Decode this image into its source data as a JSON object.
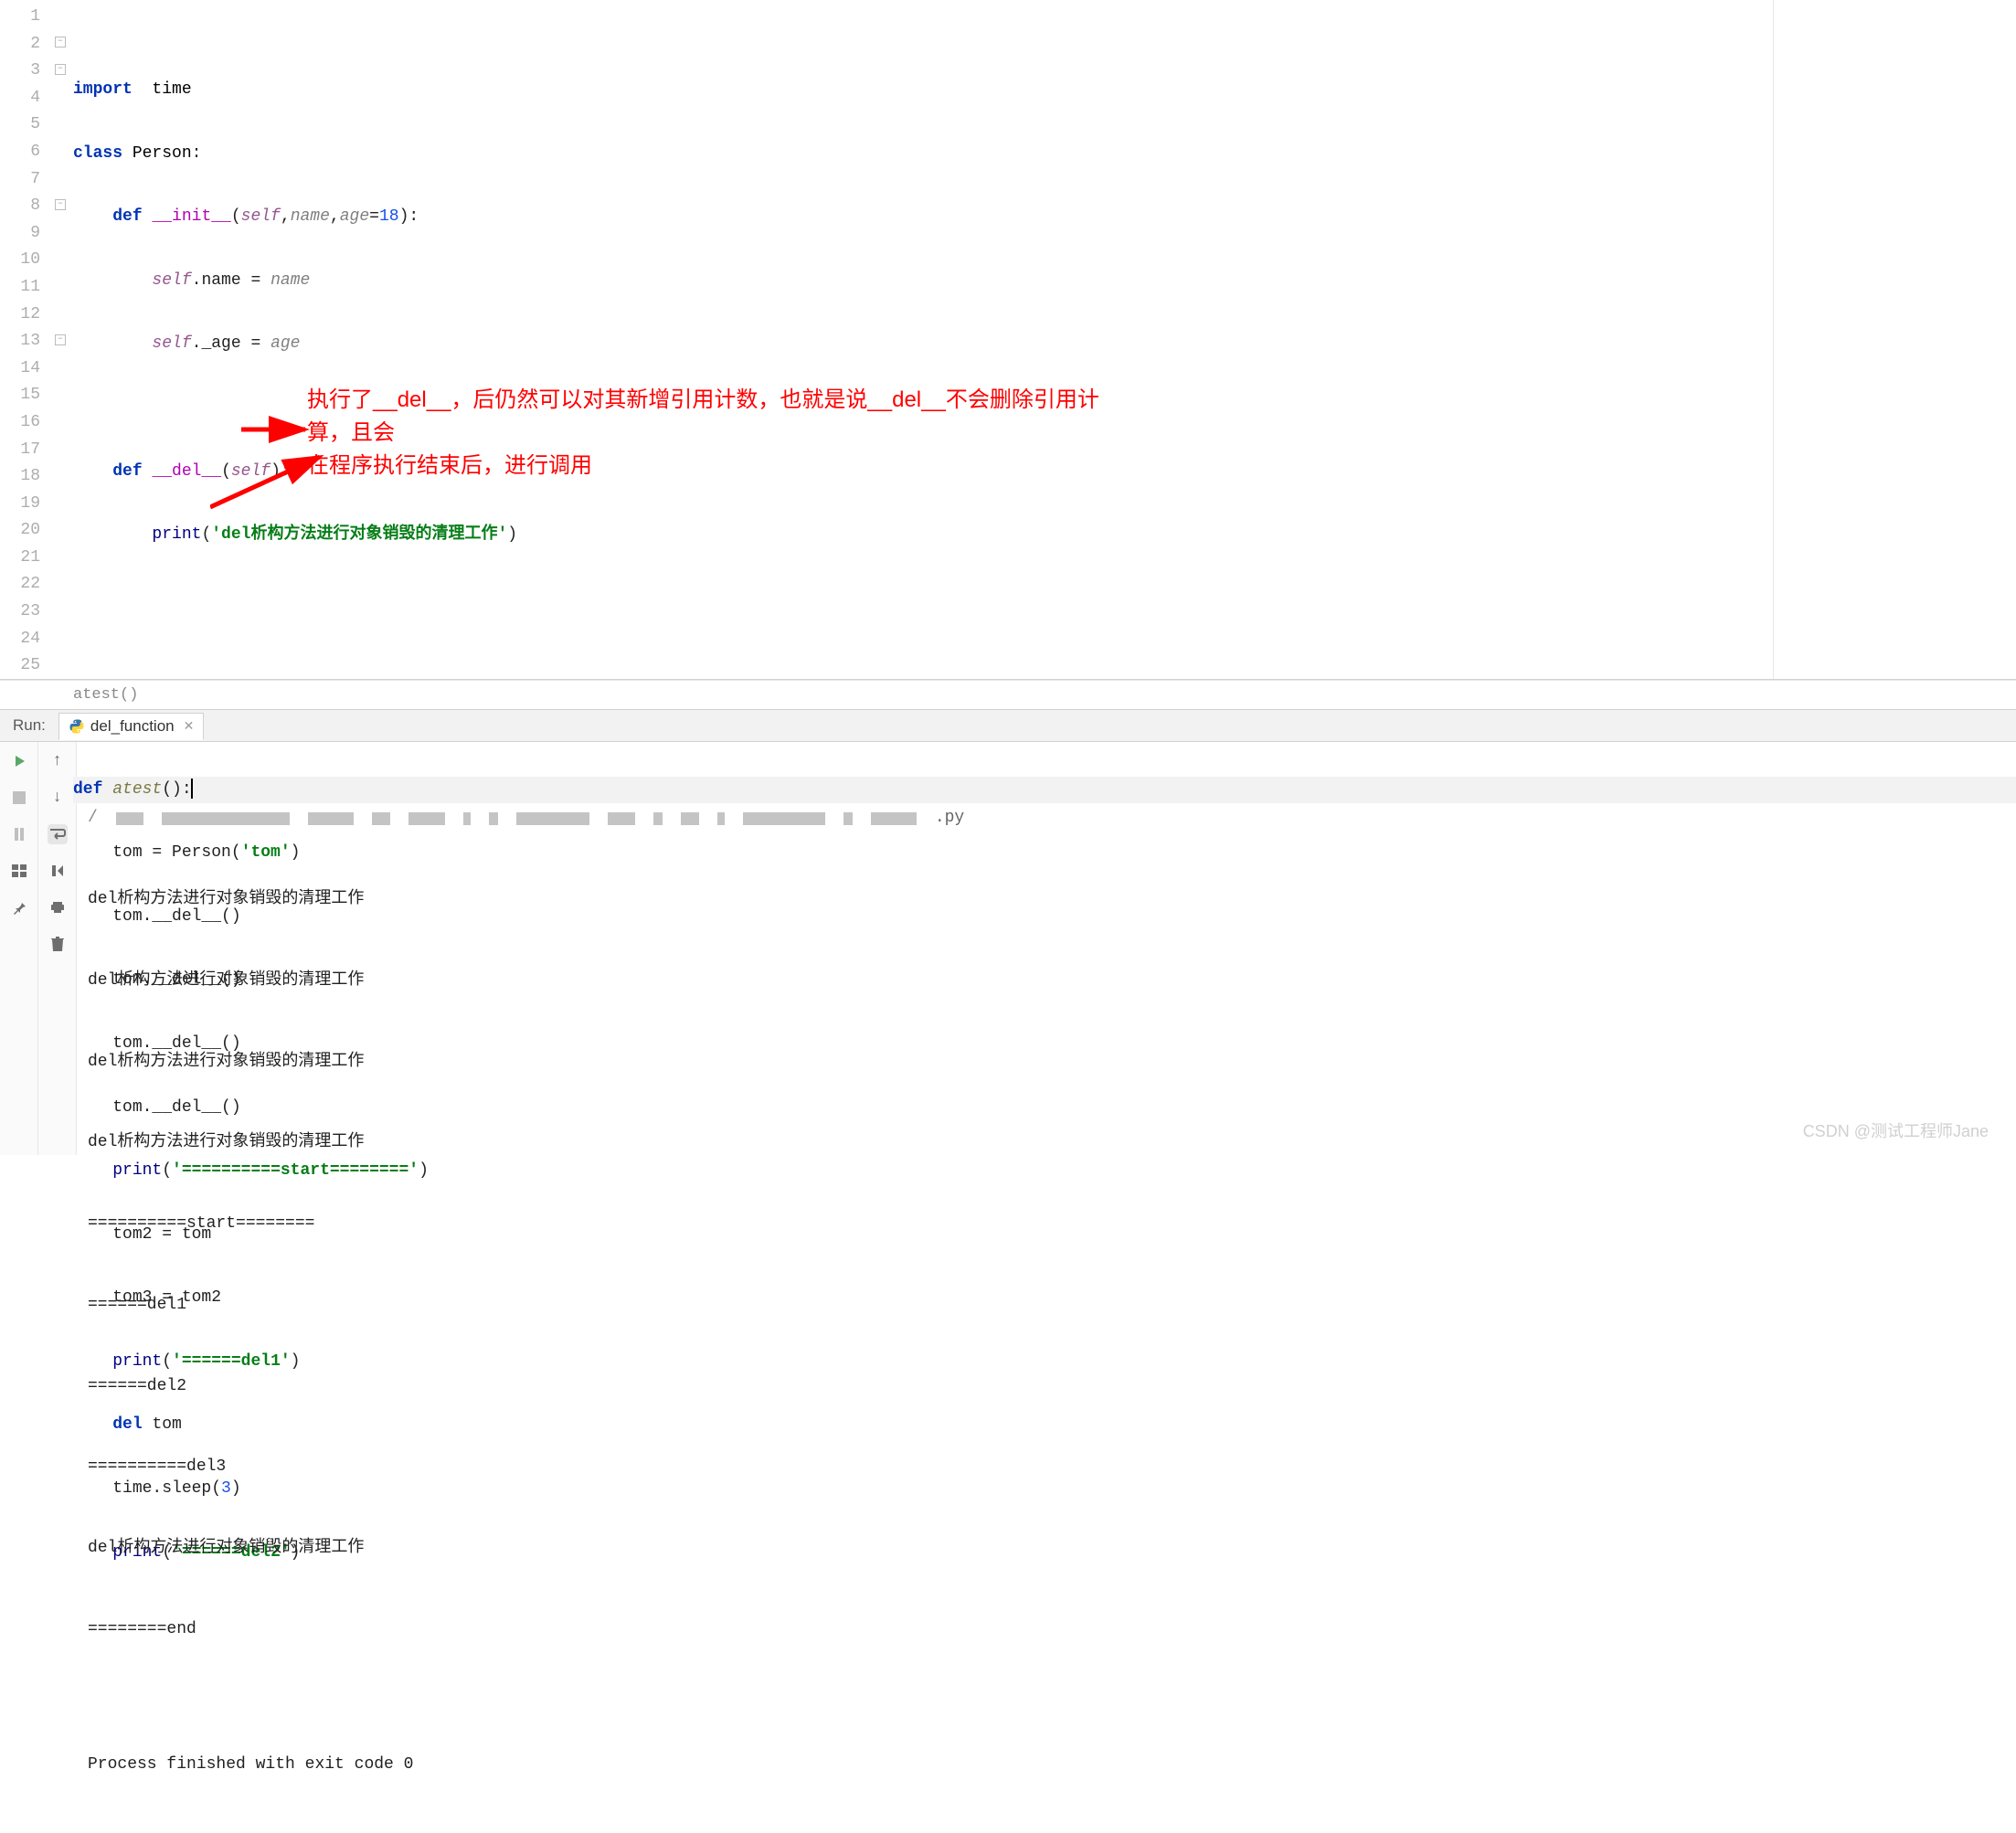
{
  "editor": {
    "lines": [
      1,
      2,
      3,
      4,
      5,
      6,
      7,
      8,
      9,
      10,
      11,
      12,
      13,
      14,
      15,
      16,
      17,
      18,
      19,
      20,
      21,
      22,
      23,
      24,
      25
    ],
    "code": {
      "l1": {
        "kw": "import",
        "sp": "  ",
        "mod": "time"
      },
      "l2": {
        "kw": "class",
        "sp": " ",
        "cls": "Person",
        "colon": ":"
      },
      "l3": {
        "ind": "    ",
        "kw": "def ",
        "fn": "__init__",
        "open": "(",
        "self": "self",
        "rest": ",",
        "p1": "name",
        "c2": ",",
        "p2": "age",
        "eq": "=",
        "num": "18",
        "close": "):"
      },
      "l4": {
        "ind": "        ",
        "self": "self",
        "dot": ".name = ",
        "param": "name"
      },
      "l5": {
        "ind": "        ",
        "self": "self",
        "dot": "._age = ",
        "param": "age"
      },
      "l6": "",
      "l7": {
        "ind": "    ",
        "kw": "def ",
        "fn": "__del__",
        "open": "(",
        "self": "self",
        "close": "):"
      },
      "l8": {
        "ind": "        ",
        "builtin": "print",
        "open": "(",
        "str": "'del析构方法进行对象销毁的清理工作'",
        "close": ")"
      },
      "l9": "",
      "l10": "",
      "l11": "",
      "l12": {
        "kw": "def ",
        "fn": "atest",
        "rest": "():"
      },
      "l13": {
        "ind": "    ",
        "var": "tom = Person(",
        "str": "'tom'",
        "close": ")"
      },
      "l14": {
        "ind": "    ",
        "txt": "tom.__del__()"
      },
      "l15": {
        "ind": "    ",
        "txt": "tom.__del__()"
      },
      "l16": {
        "ind": "    ",
        "txt": "tom.__del__()"
      },
      "l17": {
        "ind": "    ",
        "txt": "tom.__del__()"
      },
      "l18": {
        "ind": "    ",
        "builtin": "print",
        "open": "(",
        "str": "'==========start========'",
        "close": ")"
      },
      "l19": {
        "ind": "    ",
        "txt": "tom2 = tom"
      },
      "l20": {
        "ind": "    ",
        "txt": "tom3 = tom2"
      },
      "l21": {
        "ind": "    ",
        "builtin": "print",
        "open": "(",
        "str": "'======del1'",
        "close": ")"
      },
      "l22": {
        "ind": "    ",
        "kw": "del ",
        "txt": "tom"
      },
      "l23": {
        "ind": "    ",
        "txt": "time.sleep(",
        "num": "3",
        "close": ")"
      },
      "l24": {
        "ind": "    ",
        "builtin": "print",
        "open": "(",
        "str": "'======del2'",
        "close": ")"
      }
    },
    "current_line": 13,
    "annotation_l1": "执行了__del__，后仍然可以对其新增引用计数，也就是说__del__不会删除引用计算，且会",
    "annotation_l2": "在程序执行结束后，进行调用",
    "breadcrumb": "atest()"
  },
  "run": {
    "label": "Run:",
    "tab_name": "del_function",
    "console_lines": [
      "del析构方法进行对象销毁的清理工作",
      "del析构方法进行对象销毁的清理工作",
      "del析构方法进行对象销毁的清理工作",
      "del析构方法进行对象销毁的清理工作",
      "==========start========",
      "======del1",
      "======del2",
      "==========del3",
      "del析构方法进行对象销毁的清理工作",
      "========end",
      "",
      "Process finished with exit code 0"
    ],
    "blur_tail": ".py"
  },
  "watermark": "CSDN @测试工程师Jane"
}
